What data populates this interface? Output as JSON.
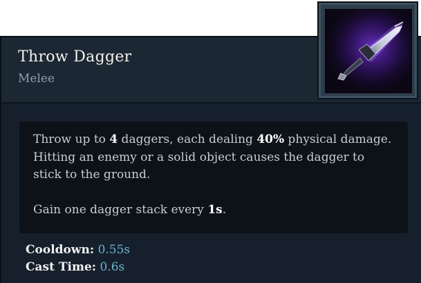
{
  "ability": {
    "name": "Throw Dagger",
    "category": "Melee",
    "icon": "dagger-icon",
    "description": {
      "p1": {
        "t1": "Throw up to ",
        "b1": "4",
        "t2": " daggers, each dealing ",
        "b2": "40%",
        "t3": " physical damage. Hitting an enemy or a solid object causes the dagger to stick to the ground."
      },
      "p2": {
        "t1": "Gain one dagger stack every ",
        "b1": "1s",
        "t2": "."
      }
    },
    "stats": [
      {
        "label": "Cooldown:",
        "value": "0.55s"
      },
      {
        "label": "Cast Time:",
        "value": "0.6s"
      }
    ]
  },
  "colors": {
    "panel_bg": "#15202c",
    "header_bg": "#1b2733",
    "desc_bg": "#0d1218",
    "stat_value": "#6fb1d3",
    "icon_glow": "#8a3dff"
  }
}
